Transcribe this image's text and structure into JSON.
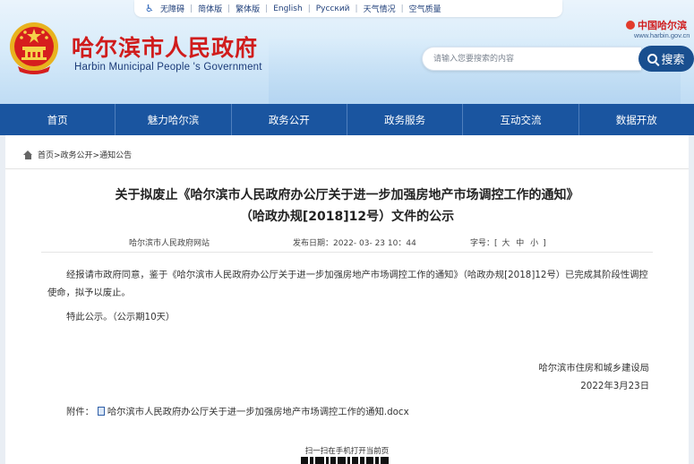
{
  "topbar": {
    "items": [
      "无障碍",
      "简体版",
      "繁体版",
      "English",
      "Русский",
      "天气情况",
      "空气质量"
    ]
  },
  "header": {
    "title_cn": "哈尔滨市人民政府",
    "title_en": "Harbin Municipal People 's Government",
    "brand_cn": "中国哈尔滨",
    "brand_url": "www.harbin.gov.cn"
  },
  "search": {
    "placeholder": "请输入您要搜索的内容",
    "button_label": "搜索"
  },
  "nav": {
    "items": [
      "首页",
      "魅力哈尔滨",
      "政务公开",
      "政务服务",
      "互动交流",
      "数据开放"
    ]
  },
  "breadcrumb": {
    "text": "首页>政务公开>通知公告"
  },
  "article": {
    "title_line1": "关于拟废止《哈尔滨市人民政府办公厅关于进一步加强房地产市场调控工作的通知》",
    "title_line2": "（哈政办规[2018]12号）文件的公示",
    "source": "哈尔滨市人民政府网站",
    "date": "发布日期：2022- 03- 23   10：44",
    "font_label": "字号：[",
    "font_sizes": [
      "大",
      "中",
      "小"
    ],
    "font_close": "]",
    "paragraph1": "经报请市政府同意，鉴于《哈尔滨市人民政府办公厅关于进一步加强房地产市场调控工作的通知》（哈政办规[2018]12号）已完成其阶段性调控使命，拟予以废止。",
    "paragraph2": "特此公示。（公示期10天）",
    "sign_org": "哈尔滨市住房和城乡建设局",
    "sign_date": "2022年3月23日",
    "attachment_label": "附件：",
    "attachment_file": "哈尔滨市人民政府办公厅关于进一步加强房地产市场调控工作的通知.docx",
    "qr_label": "扫一扫在手机打开当前页"
  },
  "colors": {
    "brand_red": "#d01c1c",
    "nav_blue": "#1a55a0",
    "search_blue": "#194f8f"
  }
}
